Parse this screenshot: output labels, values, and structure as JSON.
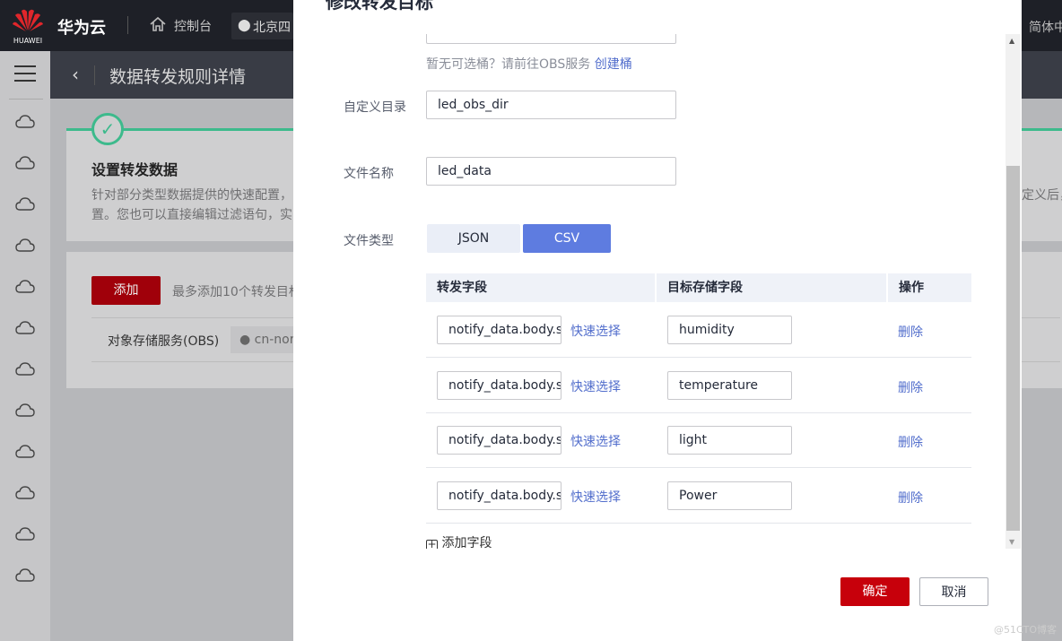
{
  "topbar": {
    "brand": "HUAWEI",
    "site": "华为云",
    "console": "控制台",
    "region": "北京四",
    "language": "简体中"
  },
  "subheader": {
    "title": "数据转发规则详情"
  },
  "sidebar": {
    "icons": [
      "cloud-icon",
      "cloud-dots-icon",
      "cloud-storage-icon",
      "wave-icon",
      "device-icon",
      "cloud-icon",
      "cloud-upload-icon",
      "cloud-down-icon",
      "rocket-icon",
      "ip-icon",
      "cluster-icon",
      "globe-icon"
    ]
  },
  "step": {
    "title": "设置转发数据",
    "desc_line1": "针对部分类型数据提供的快速配置，",
    "desc_line2": "置。您也可以直接编辑过滤语句，实",
    "desc_right": "定义后，"
  },
  "targets": {
    "add_label": "添加",
    "limit_hint": "最多添加10个转发目标",
    "service": "对象存储服务(OBS)",
    "region": "cn-nort"
  },
  "modal": {
    "title": "修改转发目标",
    "bucket_hint": "暂无可选桶？请前往OBS服务",
    "create_bucket": "创建桶",
    "dir_label": "自定义目录",
    "dir_value": "led_obs_dir",
    "file_label": "文件名称",
    "file_value": "led_data",
    "type_label": "文件类型",
    "types": [
      "JSON",
      "CSV"
    ],
    "selected_type": "CSV",
    "columns": [
      "转发字段",
      "目标存储字段",
      "操作"
    ],
    "rows": [
      {
        "source": "notify_data.body.se",
        "quick": "快速选择",
        "target": "humidity",
        "delete": "删除"
      },
      {
        "source": "notify_data.body.se",
        "quick": "快速选择",
        "target": "temperature",
        "delete": "删除"
      },
      {
        "source": "notify_data.body.se",
        "quick": "快速选择",
        "target": "light",
        "delete": "删除"
      },
      {
        "source": "notify_data.body.se",
        "quick": "快速选择",
        "target": "Power",
        "delete": "删除"
      }
    ],
    "add_field": "添加字段",
    "confirm": "确定",
    "cancel": "取消"
  },
  "watermark": "@51CTO博客",
  "colors": {
    "primary_red": "#c7000b",
    "link_blue": "#526ecc",
    "toggle_active": "#5e7ce0",
    "success_green": "#3dba8c"
  }
}
